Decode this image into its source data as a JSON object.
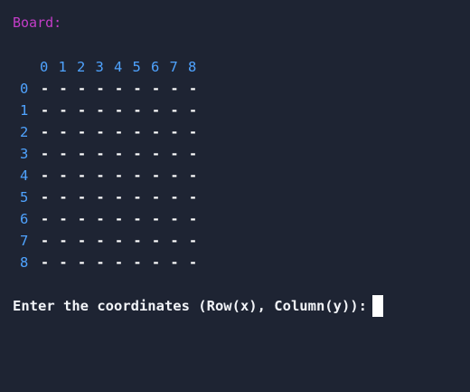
{
  "terminal": {
    "title": "Board:",
    "column_labels": [
      "0",
      "1",
      "2",
      "3",
      "4",
      "5",
      "6",
      "7",
      "8"
    ],
    "row_labels": [
      "0",
      "1",
      "2",
      "3",
      "4",
      "5",
      "6",
      "7",
      "8"
    ],
    "empty_cell": "-",
    "prompt": "Enter the coordinates (Row(x), Column(y)):",
    "colors": {
      "background": "#1e2433",
      "title": "#c33dc8",
      "labels": "#4fa3ff",
      "cells": "#ffffff",
      "prompt": "#f2f4f8"
    }
  }
}
